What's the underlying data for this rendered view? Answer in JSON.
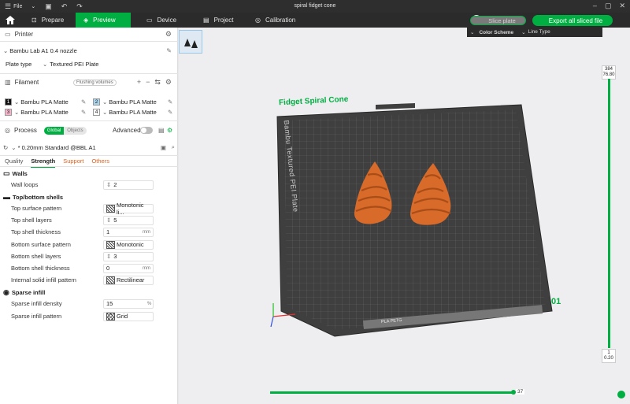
{
  "titlebar": {
    "menu_label": "File",
    "title": "spiral fidget cone"
  },
  "nav": {
    "prepare": "Prepare",
    "preview": "Preview",
    "device": "Device",
    "project": "Project",
    "calibration": "Calibration"
  },
  "toolbar": {
    "slice_label": "Slice plate",
    "export_label": "Export all sliced file"
  },
  "color_scheme": {
    "label": "Color Scheme",
    "value": "Line Type"
  },
  "printer": {
    "section_title": "Printer",
    "name": "Bambu Lab A1 0.4 nozzle",
    "plate_type_label": "Plate type",
    "plate_type_value": "Textured PEI Plate"
  },
  "filament": {
    "section_title": "Filament",
    "flushing_label": "Flushing volumes",
    "slots": [
      {
        "index": "1",
        "name": "Bambu PLA Matte",
        "color": "#111111",
        "text_color": "#ffffff"
      },
      {
        "index": "2",
        "name": "Bambu PLA Matte",
        "color": "#a9d4ea",
        "text_color": "#222222"
      },
      {
        "index": "3",
        "name": "Bambu PLA Matte",
        "color": "#f4b3c8",
        "text_color": "#222222"
      },
      {
        "index": "4",
        "name": "Bambu PLA Matte",
        "color": "#ffffff",
        "text_color": "#222222"
      }
    ]
  },
  "process": {
    "section_title": "Process",
    "global_label": "Global",
    "objects_label": "Objects",
    "advanced_label": "Advanced",
    "profile": "* 0.20mm Standard @BBL A1",
    "tabs": [
      "Quality",
      "Strength",
      "Support",
      "Others"
    ],
    "active_tab": "Strength"
  },
  "settings": {
    "walls_title": "Walls",
    "wall_loops_label": "Wall loops",
    "wall_loops_value": "2",
    "topbottom_title": "Top/bottom shells",
    "top_surface_pattern_label": "Top surface pattern",
    "top_surface_pattern_value": "Monotonic li...",
    "top_shell_layers_label": "Top shell layers",
    "top_shell_layers_value": "5",
    "top_shell_thickness_label": "Top shell thickness",
    "top_shell_thickness_value": "1",
    "bottom_surface_pattern_label": "Bottom surface pattern",
    "bottom_surface_pattern_value": "Monotonic",
    "bottom_shell_layers_label": "Bottom shell layers",
    "bottom_shell_layers_value": "3",
    "bottom_shell_thickness_label": "Bottom shell thickness",
    "bottom_shell_thickness_value": "0",
    "internal_infill_pattern_label": "Internal solid infill pattern",
    "internal_infill_pattern_value": "Rectilinear",
    "sparse_title": "Sparse infill",
    "sparse_density_label": "Sparse infill density",
    "sparse_density_value": "15",
    "sparse_pattern_label": "Sparse infill pattern",
    "sparse_pattern_value": "Grid",
    "unit_mm": "mm",
    "unit_pct": "%"
  },
  "viewport": {
    "plate_name": "Fidget Spiral Cone",
    "plate_side_text": "Bambu Textured PEI Plate",
    "plate_number": "01",
    "plate_label_text": "PLA PETG",
    "layer_top": "384",
    "layer_top_height": "76.80",
    "layer_bottom": "1",
    "layer_bottom_height": "0.20",
    "move_value": "37"
  },
  "colors": {
    "accent": "#00ae42",
    "model": "#e0651d"
  }
}
